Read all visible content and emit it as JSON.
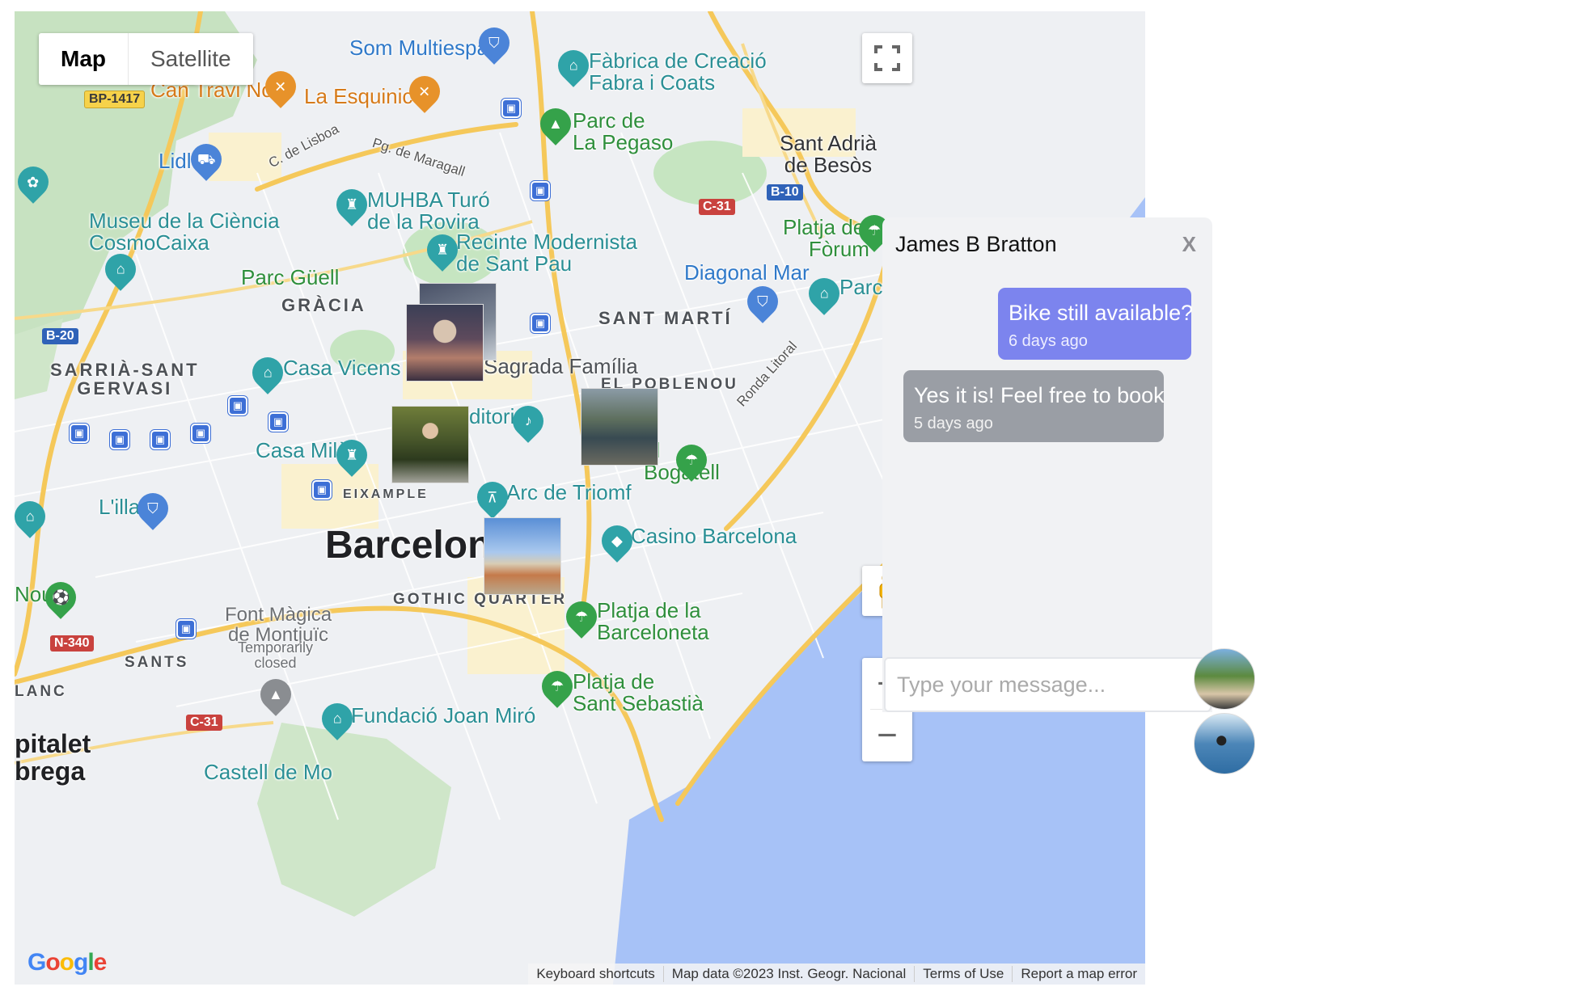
{
  "map": {
    "type_buttons": {
      "map": "Map",
      "satellite": "Satellite"
    },
    "city": "Barcelona",
    "districts": {
      "gracia": "GRÀCIA",
      "sarria": "SARRIÀ-SANT\nGERVASI",
      "sant_marti": "SANT MARTÍ",
      "poblenou": "EL POBLENOU",
      "eixample": "EIXAMPLE",
      "gothic": "GOTHIC QUARTER",
      "sants": "SANTS",
      "lanc": "LANC"
    },
    "pois": {
      "som_multiespai": "Som Multiespai",
      "fabrica": "Fàbrica de Creació\nFabra i Coats",
      "can_travi": "Can Travi Nou",
      "la_esquinica": "La Esquinica",
      "parc_pegaso": "Parc de\nLa Pegaso",
      "sant_adria": "Sant Adrià\nde Besòs",
      "lidl": "Lidl",
      "muhba": "MUHBA Turó\nde la Rovira",
      "museu_ciencia": "Museu de la Ciència\nCosmoCaixa",
      "recinte": "Recinte Modernista\nde Sant Pau",
      "platja_forum": "Platja del\nFòrum",
      "parc_gueell": "Parc Güell",
      "diagonal_mar": "Diagonal Mar",
      "parc_partial": "Parc",
      "casa_vicens": "Casa Vicens",
      "sagrada": "Sagrada Família",
      "auditori": "ditori",
      "casa_mila": "Casa Milà",
      "bogatell": "el\nBogatell",
      "lilla": "L'illa",
      "arc_triomf": "Arc de Triomf",
      "casino": "Casino Barcelona",
      "nou": "Nou",
      "font_magica": "Font Màgica\nde Montjuïc",
      "temporarily_closed": "Temporarily\nclosed",
      "platja_barceloneta": "Platja de la\nBarceloneta",
      "platja_sebastia": "Platja de\nSant Sebastià",
      "fundacio_miro": "Fundació Joan Miró",
      "castell": "Castell de Mo",
      "hospitalet": "pitalet\nbrega"
    },
    "roads": {
      "lisboa": "C. de Lisboa",
      "maragall": "Pg. de Maragall",
      "ronda": "Ronda Litoral"
    },
    "shields": {
      "bp1417": "BP-1417",
      "b10": "B-10",
      "c31_top": "C-31",
      "b20": "B-20",
      "n340": "N-340",
      "c31_bottom": "C-31"
    },
    "attribution": [
      "Keyboard shortcuts",
      "Map data ©2023 Inst. Geogr. Nacional",
      "Terms of Use",
      "Report a map error"
    ],
    "google_logo": "Google"
  },
  "chat": {
    "contact_name": "James B Bratton",
    "close_label": "X",
    "messages": [
      {
        "text": "Bike still available?",
        "time": "6 days ago",
        "direction": "outgoing"
      },
      {
        "text": "Yes it is! Feel free to book",
        "time": "5 days ago",
        "direction": "incoming"
      }
    ],
    "input_placeholder": "Type your message..."
  },
  "colors": {
    "outgoing_bubble": "#7c84ee",
    "incoming_bubble": "#9a9ea5",
    "water": "#a7c2f7",
    "park": "#bfe3bf",
    "highway": "#f5c85a"
  }
}
